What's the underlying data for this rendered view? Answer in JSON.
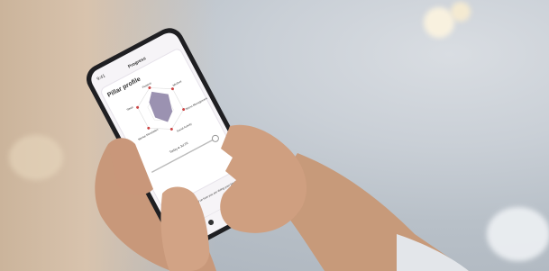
{
  "phone": {
    "status_time": "9:41",
    "header_title": "Progress",
    "card_title": "Pillar profile",
    "radar_labels": {
      "top": "Purpose",
      "top_right": "Mindset",
      "right": "Stress Management",
      "bottom_right": "Social Activity",
      "bottom_left": "Mental Stimulation",
      "left": "Sleep"
    },
    "slider_label": "Today ● Jul 26",
    "body_text": "Your pillar profile is based on how you are doing your best at achievement with the wisdom of your habits.",
    "nav_icons": [
      "home-icon",
      "progress-icon",
      "profile-icon",
      "settings-icon"
    ]
  },
  "colors": {
    "radar_fill": "#8a7fa3",
    "card_bg": "#ffffff",
    "accent_dot": "#c44"
  }
}
